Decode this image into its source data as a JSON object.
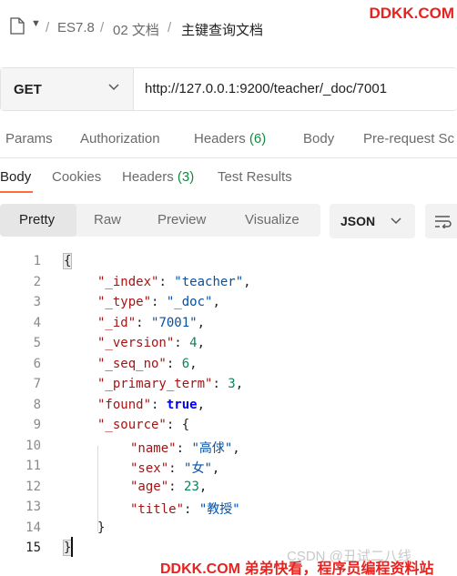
{
  "breadcrumb": {
    "segments": [
      "ES7.8",
      "02 文档"
    ],
    "separator": "/",
    "current": "主键查询文档"
  },
  "watermarks": {
    "top": "DDKK.COM",
    "bottom": "DDKK.COM 弟弟快看，程序员编程资料站",
    "csdn": "CSDN @丑试二八线"
  },
  "request": {
    "method": "GET",
    "url": "http://127.0.0.1:9200/teacher/_doc/7001"
  },
  "request_tabs": {
    "params": "Params",
    "authorization": "Authorization",
    "headers": "Headers",
    "headers_count": "(6)",
    "body": "Body",
    "prerequest": "Pre-request Sc"
  },
  "response_tabs": {
    "body": "Body",
    "cookies": "Cookies",
    "headers": "Headers",
    "headers_count": "(3)",
    "test_results": "Test Results"
  },
  "view_modes": {
    "pretty": "Pretty",
    "raw": "Raw",
    "preview": "Preview",
    "visualize": "Visualize",
    "active": "Pretty"
  },
  "format": "JSON",
  "code": {
    "line_numbers": [
      "1",
      "2",
      "3",
      "4",
      "5",
      "6",
      "7",
      "8",
      "9",
      "10",
      "11",
      "12",
      "13",
      "14",
      "15"
    ],
    "open_brace": "{",
    "close_brace": "}",
    "fields": {
      "index_key": "\"_index\"",
      "index_val": "\"teacher\"",
      "type_key": "\"_type\"",
      "type_val": "\"_doc\"",
      "id_key": "\"_id\"",
      "id_val": "\"7001\"",
      "version_key": "\"_version\"",
      "version_val": "4",
      "seq_key": "\"_seq_no\"",
      "seq_val": "6",
      "term_key": "\"_primary_term\"",
      "term_val": "3",
      "found_key": "\"found\"",
      "found_val": "true",
      "source_key": "\"_source\"",
      "source_open": "{",
      "name_key": "\"name\"",
      "name_val": "\"高俅\"",
      "sex_key": "\"sex\"",
      "sex_val": "\"女\"",
      "age_key": "\"age\"",
      "age_val": "23",
      "title_key": "\"title\"",
      "title_val": "\"教授\"",
      "source_close": "}"
    }
  }
}
